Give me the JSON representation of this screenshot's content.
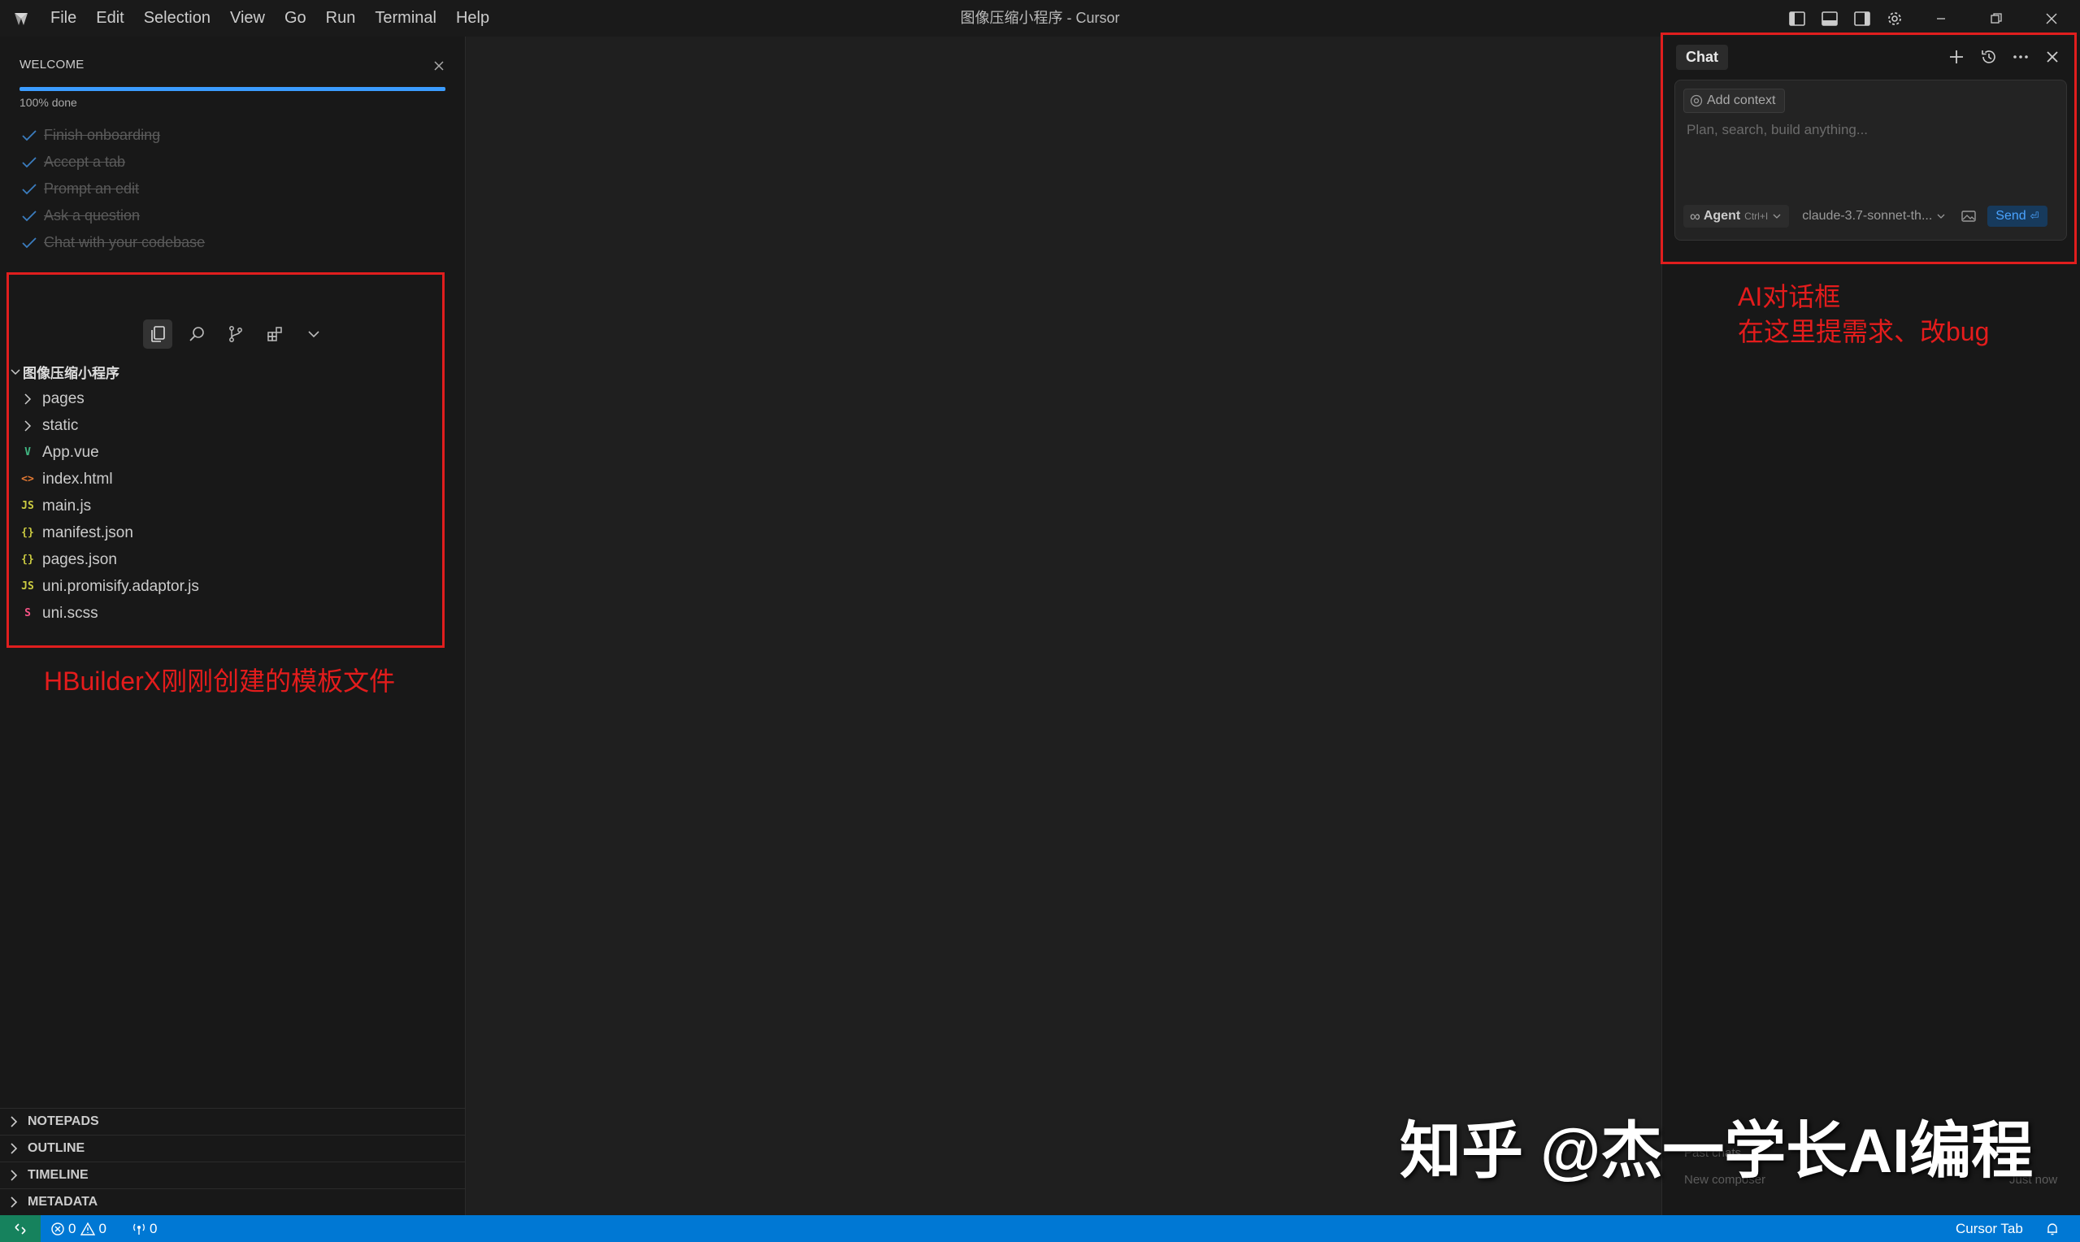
{
  "window": {
    "title": "图像压缩小程序 - Cursor",
    "menu": [
      "File",
      "Edit",
      "Selection",
      "View",
      "Go",
      "Run",
      "Terminal",
      "Help"
    ]
  },
  "welcome": {
    "title": "WELCOME",
    "progress_percent": 100,
    "progress_label": "100% done",
    "checklist": [
      "Finish onboarding",
      "Accept a tab",
      "Prompt an edit",
      "Ask a question",
      "Chat with your codebase"
    ]
  },
  "explorer": {
    "root": "图像压缩小程序",
    "items": [
      {
        "name": "pages",
        "type": "folder",
        "icon": "chevron-right-icon"
      },
      {
        "name": "static",
        "type": "folder",
        "icon": "chevron-right-icon"
      },
      {
        "name": "App.vue",
        "type": "vue",
        "icon": "vue-icon",
        "glyph": "V",
        "color": "#41b883"
      },
      {
        "name": "index.html",
        "type": "html",
        "icon": "html-icon",
        "glyph": "<>",
        "color": "#e37933"
      },
      {
        "name": "main.js",
        "type": "js",
        "icon": "js-icon",
        "glyph": "JS",
        "color": "#cbcb41"
      },
      {
        "name": "manifest.json",
        "type": "json",
        "icon": "json-icon",
        "glyph": "{}",
        "color": "#cbcb41"
      },
      {
        "name": "pages.json",
        "type": "json",
        "icon": "json-icon",
        "glyph": "{}",
        "color": "#cbcb41"
      },
      {
        "name": "uni.promisify.adaptor.js",
        "type": "js",
        "icon": "js-icon",
        "glyph": "JS",
        "color": "#cbcb41"
      },
      {
        "name": "uni.scss",
        "type": "scss",
        "icon": "sass-icon",
        "glyph": "S",
        "color": "#f55385"
      }
    ]
  },
  "annotations": {
    "explorer_note": "HBuilderX刚刚创建的模板文件",
    "chat_note_line1": "AI对话框",
    "chat_note_line2": "在这里提需求、改bug"
  },
  "panels": [
    "NOTEPADS",
    "OUTLINE",
    "TIMELINE",
    "METADATA"
  ],
  "chat": {
    "tab_label": "Chat",
    "add_context": "Add context",
    "placeholder": "Plan, search, build anything...",
    "mode": "Agent",
    "mode_shortcut": "Ctrl+I",
    "model": "claude-3.7-sonnet-th...",
    "send_label": "Send",
    "ghost_new_composer": "New composer",
    "ghost_just_now": "Just now",
    "ghost_past_chats": "Past chats"
  },
  "watermark": "知乎 @杰一学长AI编程",
  "statusbar": {
    "errors": "0",
    "warnings": "0",
    "ports": "0",
    "right_label": "Cursor Tab"
  },
  "colors": {
    "accent": "#0078d4",
    "annotation_red": "#e01e1e",
    "progress": "#3b9cff",
    "remote": "#16825d"
  }
}
